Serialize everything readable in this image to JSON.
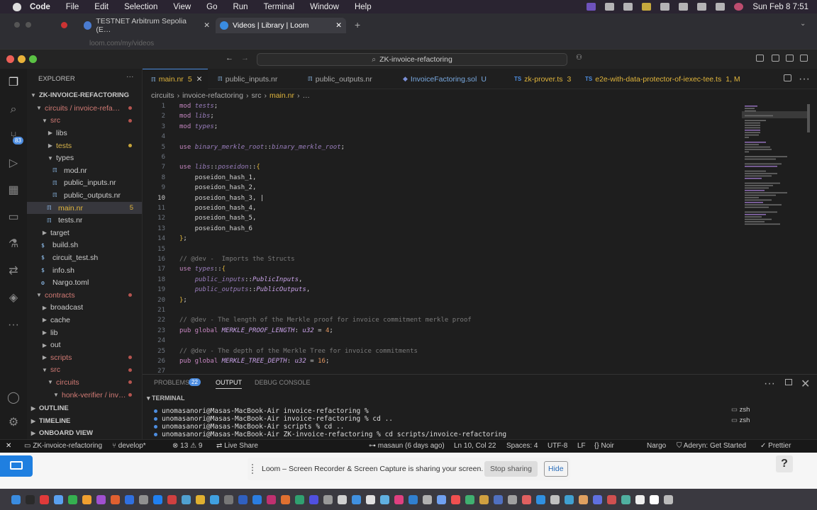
{
  "menubar": {
    "items": [
      "Code",
      "File",
      "Edit",
      "Selection",
      "View",
      "Go",
      "Run",
      "Terminal",
      "Window",
      "Help"
    ],
    "clock": "Sun Feb 8  7:51"
  },
  "browser": {
    "tabs": [
      {
        "label": "TESTNET Arbitrum Sepolia (E…"
      },
      {
        "label": "Videos | Library | Loom"
      }
    ],
    "url": "loom.com/my/videos"
  },
  "window": {
    "search": "ZK-invoice-refactoring"
  },
  "activity": {
    "source_control_badge": "83"
  },
  "sidebar": {
    "header": "EXPLORER",
    "root": "ZK-INVOICE-REFACTORING",
    "items": [
      {
        "label": "circuits / invoice-refa…",
        "type": "folder-open",
        "indent": 1,
        "dot": "red"
      },
      {
        "label": "src",
        "type": "folder-open",
        "indent": 2,
        "dot": "red"
      },
      {
        "label": "libs",
        "type": "folder",
        "indent": 3
      },
      {
        "label": "tests",
        "type": "folder",
        "indent": 3,
        "dot": "yellow"
      },
      {
        "label": "types",
        "type": "folder-open",
        "indent": 3
      },
      {
        "label": "mod.nr",
        "type": "file",
        "indent": 4
      },
      {
        "label": "public_inputs.nr",
        "type": "file",
        "indent": 4
      },
      {
        "label": "public_outputs.nr",
        "type": "file",
        "indent": 4
      },
      {
        "label": "main.nr",
        "type": "file",
        "indent": 3,
        "count": "5",
        "selected": true
      },
      {
        "label": "tests.nr",
        "type": "file",
        "indent": 3
      },
      {
        "label": "target",
        "type": "folder",
        "indent": 2
      },
      {
        "label": "build.sh",
        "type": "file",
        "indent": 2
      },
      {
        "label": "circuit_test.sh",
        "type": "file",
        "indent": 2
      },
      {
        "label": "info.sh",
        "type": "file",
        "indent": 2
      },
      {
        "label": "Nargo.toml",
        "type": "file",
        "indent": 2
      },
      {
        "label": "contracts",
        "type": "folder-open",
        "indent": 1,
        "dot": "red"
      },
      {
        "label": "broadcast",
        "type": "folder",
        "indent": 2
      },
      {
        "label": "cache",
        "type": "folder",
        "indent": 2
      },
      {
        "label": "lib",
        "type": "folder",
        "indent": 2
      },
      {
        "label": "out",
        "type": "folder",
        "indent": 2
      },
      {
        "label": "scripts",
        "type": "folder",
        "indent": 2,
        "dot": "red"
      },
      {
        "label": "src",
        "type": "folder-open",
        "indent": 2,
        "dot": "red"
      },
      {
        "label": "circuits",
        "type": "folder-open",
        "indent": 3,
        "dot": "red"
      },
      {
        "label": "honk-verifier / inv…",
        "type": "folder-open",
        "indent": 4,
        "dot": "red"
      }
    ],
    "sections": [
      "OUTLINE",
      "TIMELINE",
      "ONBOARD VIEW"
    ]
  },
  "editor": {
    "tabs": [
      {
        "label": "main.nr",
        "badge": "5",
        "active": true
      },
      {
        "label": "public_inputs.nr"
      },
      {
        "label": "public_outputs.nr"
      },
      {
        "label": "InvoiceFactoring.sol",
        "badge": "U"
      },
      {
        "label": "zk-prover.ts",
        "badge": "3"
      },
      {
        "label": "e2e-with-data-protector-of-iexec-tee.ts",
        "badge": "1, M"
      }
    ],
    "breadcrumb": [
      "circuits",
      "invoice-refactoring",
      "src",
      "main.nr",
      "…"
    ],
    "current_line": 10,
    "lines": [
      {
        "n": "1",
        "html": "<span class='kw'>mod</span> <span class='id'>tests</span>;"
      },
      {
        "n": "2",
        "html": "<span class='kw'>mod</span> <span class='id'>libs</span>;"
      },
      {
        "n": "3",
        "html": "<span class='kw'>mod</span> <span class='id'>types</span>;"
      },
      {
        "n": "4",
        "html": ""
      },
      {
        "n": "5",
        "html": "<span class='kw'>use</span> <span class='id'>binary_merkle_root</span>::<span class='id'>binary_merkle_root</span>;"
      },
      {
        "n": "6",
        "html": ""
      },
      {
        "n": "7",
        "html": "<span class='kw'>use</span> <span class='id'>libs</span>::<span class='id'>poseidon</span>::<span class='cs'>{</span>"
      },
      {
        "n": "8",
        "html": "    poseidon_hash_1,"
      },
      {
        "n": "9",
        "html": "    poseidon_hash_2,"
      },
      {
        "n": "10",
        "html": "    poseidon_hash_3, |"
      },
      {
        "n": "11",
        "html": "    poseidon_hash_4,"
      },
      {
        "n": "12",
        "html": "    poseidon_hash_5,"
      },
      {
        "n": "13",
        "html": "    poseidon_hash_6"
      },
      {
        "n": "14",
        "html": "<span class='cs'>}</span>;"
      },
      {
        "n": "15",
        "html": ""
      },
      {
        "n": "16",
        "html": "<span class='cm'>// @dev -  Imports the Structs</span>"
      },
      {
        "n": "17",
        "html": "<span class='kw'>use</span> <span class='id'>types</span>::<span class='cs'>{</span>"
      },
      {
        "n": "18",
        "html": "    <span class='id'>public_inputs</span>::<span class='ty'>PublicInputs</span>,"
      },
      {
        "n": "19",
        "html": "    <span class='id'>public_outputs</span>::<span class='ty'>PublicOutputs</span>,"
      },
      {
        "n": "20",
        "html": "<span class='cs'>}</span>;"
      },
      {
        "n": "21",
        "html": ""
      },
      {
        "n": "22",
        "html": "<span class='cm'>// @dev - The length of the Merkle proof for invoice commitment merkle proof</span>"
      },
      {
        "n": "23",
        "html": "<span class='kw'>pub global</span> <span class='ty'>MERKLE_PROOF_LENGTH</span>: <span class='ty'>u32</span> = <span class='nm'>4</span>;"
      },
      {
        "n": "24",
        "html": ""
      },
      {
        "n": "25",
        "html": "<span class='cm'>// @dev - The depth of the Merkle Tree for invoice commitments</span>"
      },
      {
        "n": "26",
        "html": "<span class='kw'>pub global</span> <span class='ty'>MERKLE_TREE_DEPTH</span>: <span class='ty'>u32</span> = <span class='nm'>16</span>;"
      },
      {
        "n": "27",
        "html": ""
      }
    ]
  },
  "panel": {
    "tabs": [
      {
        "label": "PROBLEMS",
        "badge": "22"
      },
      {
        "label": "OUTPUT"
      },
      {
        "label": "DEBUG CONSOLE"
      }
    ],
    "terminal_header": "TERMINAL",
    "terminal_lines": [
      "unomasanori@Masas-MacBook-Air invoice-refactoring % ",
      "unomasanori@Masas-MacBook-Air invoice-refactoring % cd ..",
      "unomasanori@Masas-MacBook-Air scripts % cd ..",
      "unomasanori@Masas-MacBook-Air ZK-invoice-refactoring % cd scripts/invoice-refactoring"
    ],
    "shells": [
      "zsh",
      "zsh"
    ]
  },
  "statusbar": {
    "repo": "ZK-invoice-refactoring",
    "branch": "develop*",
    "errors": "13",
    "warnings": "9",
    "live_share": "Live Share",
    "blame": "masaun (6 days ago)",
    "position": "Ln 10, Col 22",
    "spaces": "Spaces: 4",
    "encoding": "UTF-8",
    "eol": "LF",
    "language": "Noir",
    "nargo": "Nargo",
    "aderyn": "Aderyn: Get Started",
    "prettier": "Prettier"
  },
  "loom": {
    "message": "Loom – Screen Recorder & Screen Capture is sharing your screen.",
    "stop": "Stop sharing",
    "hide": "Hide"
  }
}
